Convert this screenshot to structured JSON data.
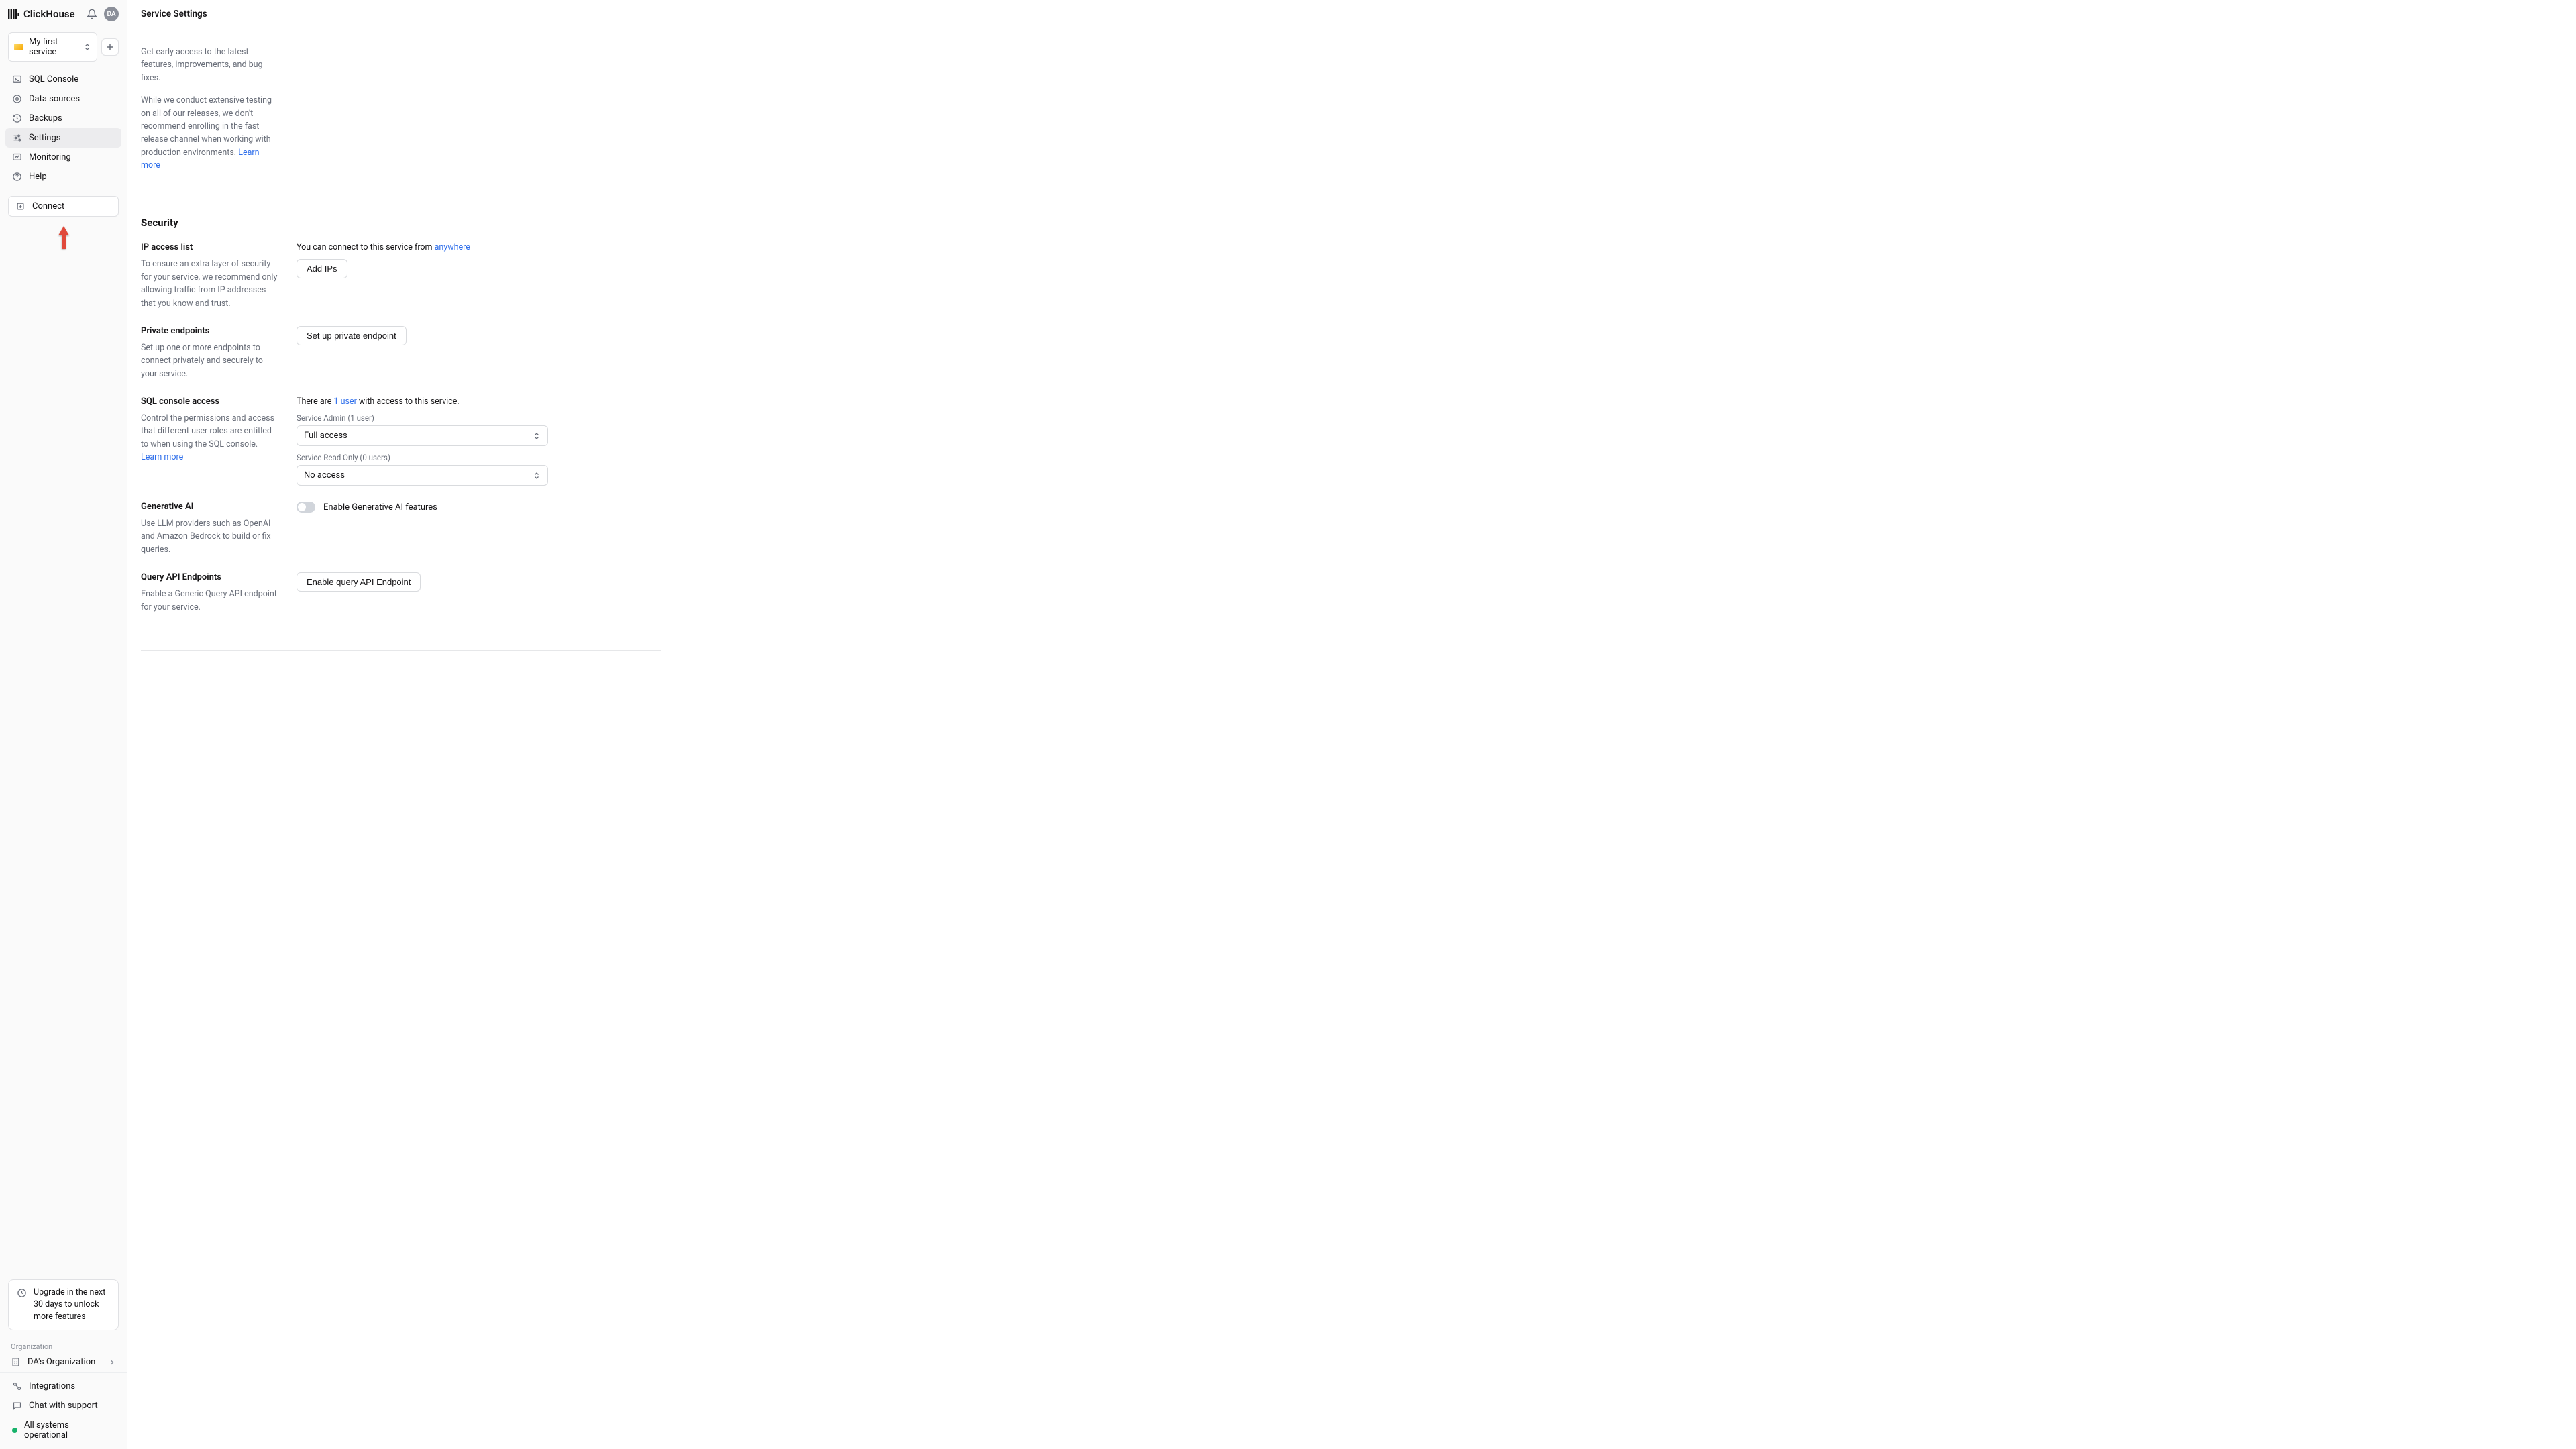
{
  "brand": "ClickHouse",
  "avatar_initials": "DA",
  "service_selector": {
    "name": "My first service"
  },
  "nav": {
    "sql_console": "SQL Console",
    "data_sources": "Data sources",
    "backups": "Backups",
    "settings": "Settings",
    "monitoring": "Monitoring",
    "help": "Help",
    "connect": "Connect"
  },
  "upgrade_msg": "Upgrade in the next 30 days to unlock more features",
  "org_label": "Organization",
  "org_name": "DA's Organization",
  "bottom": {
    "integrations": "Integrations",
    "chat": "Chat with support",
    "status": "All systems operational"
  },
  "topbar_title": "Service Settings",
  "release": {
    "desc1": "Get early access to the latest features, improvements, and bug fixes.",
    "desc2_a": "While we conduct extensive testing on all of our releases, we don't recommend enrolling in the fast release channel when working with production environments. ",
    "learn_more": "Learn more"
  },
  "security_title": "Security",
  "ip_access": {
    "title": "IP access list",
    "desc": "To ensure an extra layer of security for your service, we recommend only allowing traffic from IP addresses that you know and trust.",
    "status_prefix": "You can connect to this service from ",
    "status_link": "anywhere",
    "button": "Add IPs"
  },
  "private_ep": {
    "title": "Private endpoints",
    "desc": "Set up one or more endpoints to connect privately and securely to your service.",
    "button": "Set up private endpoint"
  },
  "sql_access": {
    "title": "SQL console access",
    "desc_a": "Control the permissions and access that different user roles are entitled to when using the SQL console. ",
    "learn_more": "Learn more",
    "status_a": "There are ",
    "status_link": "1 user",
    "status_b": " with access to this service.",
    "admin_label": "Service Admin (1 user)",
    "admin_value": "Full access",
    "readonly_label": "Service Read Only (0 users)",
    "readonly_value": "No access"
  },
  "genai": {
    "title": "Generative AI",
    "desc": "Use LLM providers such as OpenAI and Amazon Bedrock to build or fix queries.",
    "toggle_label": "Enable Generative AI features"
  },
  "query_api": {
    "title": "Query API Endpoints",
    "desc": "Enable a Generic Query API endpoint for your service.",
    "button": "Enable query API Endpoint"
  }
}
